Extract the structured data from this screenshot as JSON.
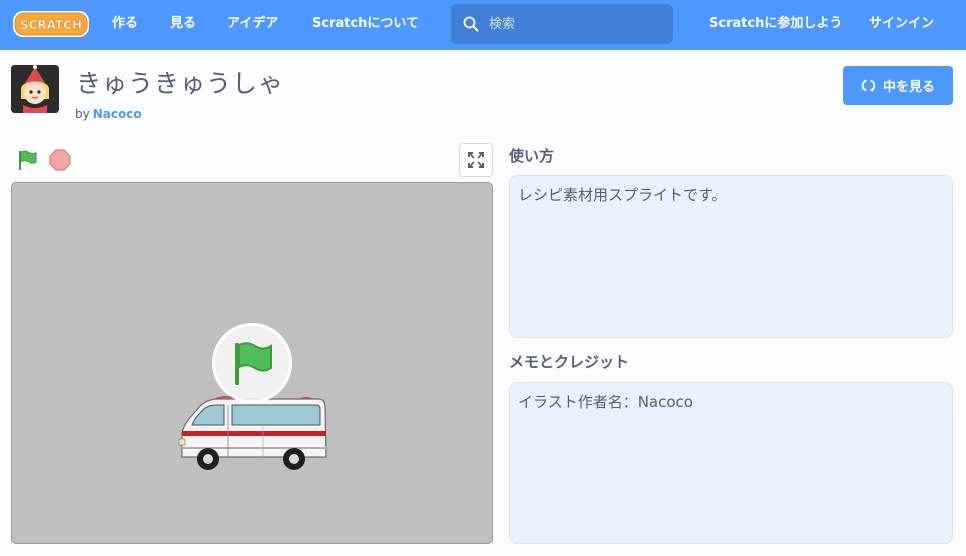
{
  "nav": {
    "logo_text": "SCRATCH",
    "links": [
      "作る",
      "見る",
      "アイデア",
      "Scratchについて"
    ],
    "search_placeholder": "検索",
    "join_label": "Scratchに参加しよう",
    "signin_label": "サインイン"
  },
  "project": {
    "title": "きゅうきゅうしゃ",
    "by_label": "by",
    "author": "Nacoco",
    "see_inside_label": "中を見る"
  },
  "instructions": {
    "title": "使い方",
    "text": "レシピ素材用スプライトです。"
  },
  "notes": {
    "title": "メモとクレジット",
    "text": "イラスト作者名：Nacoco"
  },
  "icons": {
    "search": "search-icon",
    "green_flag": "green-flag-icon",
    "stop": "stop-icon",
    "fullscreen": "fullscreen-icon",
    "remix": "remix-icon"
  },
  "colors": {
    "nav": "#4d97ff",
    "search_bg": "#4280d7",
    "stage_bg": "#bfbfbf",
    "box_bg": "#e9f1fc",
    "text": "#575e75",
    "green_flag": "#4cbf56",
    "stop": "#ec5959"
  }
}
